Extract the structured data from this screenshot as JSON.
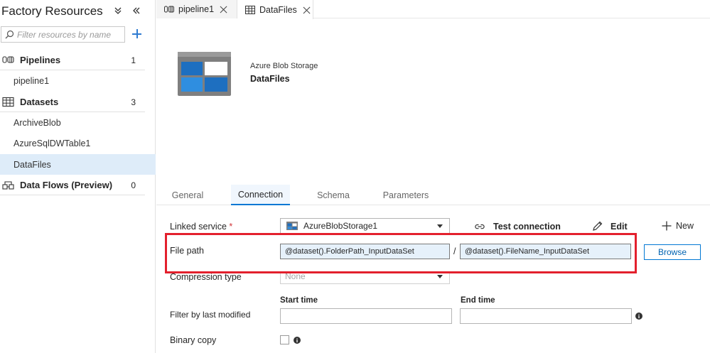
{
  "sidebar": {
    "title": "Factory Resources",
    "search_placeholder": "Filter resources by name",
    "sections": {
      "pipelines": {
        "label": "Pipelines",
        "count": "1"
      },
      "datasets": {
        "label": "Datasets",
        "count": "3"
      },
      "dataflows": {
        "label": "Data Flows (Preview)",
        "count": "0"
      }
    },
    "pipelines": [
      "pipeline1"
    ],
    "datasets": [
      "ArchiveBlob",
      "AzureSqlDWTable1",
      "DataFiles"
    ],
    "selected_item": "DataFiles"
  },
  "tabs": [
    {
      "label": "pipeline1",
      "icon": "pipeline-icon",
      "active": false
    },
    {
      "label": "DataFiles",
      "icon": "table-icon",
      "active": true
    }
  ],
  "dataset": {
    "type": "Azure Blob Storage",
    "name": "DataFiles"
  },
  "subtabs": [
    "General",
    "Connection",
    "Schema",
    "Parameters"
  ],
  "active_subtab": "Connection",
  "connection": {
    "linked_service_label": "Linked service",
    "required_marker": "*",
    "linked_service_value": "AzureBlobStorage1",
    "test_connection": "Test connection",
    "edit": "Edit",
    "new": "New",
    "file_path_label": "File path",
    "folder_path": "@dataset().FolderPath_InputDataSet",
    "path_separator": "/",
    "file_name": "@dataset().FileName_InputDataSet",
    "browse": "Browse",
    "compression_label": "Compression type",
    "compression_value": "None",
    "filter_label": "Filter by last modified",
    "start_time_label": "Start time",
    "end_time_label": "End time",
    "binary_copy_label": "Binary copy",
    "info_glyph": "i"
  },
  "colors": {
    "accent": "#0078d4",
    "highlight_box": "#e3202d",
    "selected_row": "#deecf9",
    "input_fill": "#e6f1fb"
  }
}
